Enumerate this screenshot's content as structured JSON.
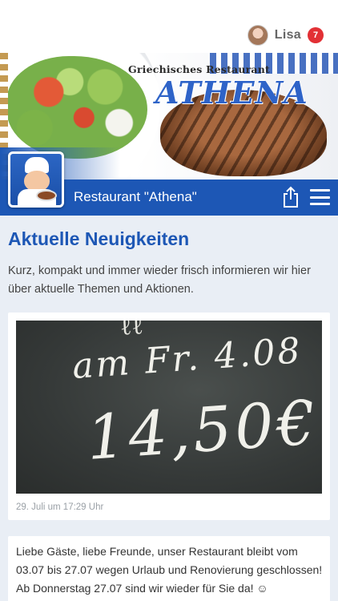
{
  "header": {
    "user_name": "Lisa",
    "notification_count": "7"
  },
  "hero": {
    "brand_subtitle": "Griechisches Restaurant",
    "brand_name": "ATHENA"
  },
  "titlebar": {
    "title": "Restaurant \"Athena\"",
    "share_icon": "share-icon",
    "menu_icon": "hamburger-menu-icon"
  },
  "news": {
    "section_title": "Aktuelle Neuigkeiten",
    "intro": "Kurz, kompakt und immer wieder frisch informieren wir hier über aktuelle Themen und Aktionen.",
    "posts": [
      {
        "image_text_top": "am Fr. 4.08",
        "image_text_price": "14,50€",
        "date": "29. Juli um 17:29 Uhr"
      },
      {
        "text": "Liebe Gäste, liebe Freunde, unser Restaurant bleibt vom 03.07 bis 27.07 wegen Urlaub und Renovierung geschlossen! Ab Donnerstag 27.07 sind wir wieder für Sie da! ☺"
      }
    ]
  },
  "colors": {
    "primary_blue": "#1d57b5",
    "badge_red": "#e23035",
    "background": "#e9eef5"
  }
}
